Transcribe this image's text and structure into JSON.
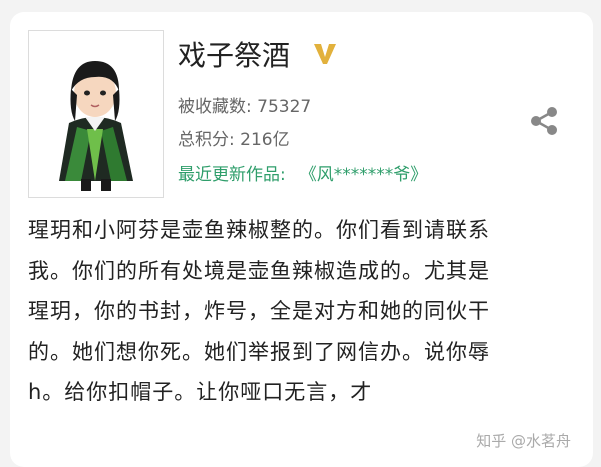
{
  "profile": {
    "author_name": "戏子祭酒",
    "favorites_label": "被收藏数:",
    "favorites_value": "75327",
    "score_label": "总积分:",
    "score_value": "216亿",
    "latest_label": "最近更新作品:",
    "latest_work": "《风*******爷》"
  },
  "icons": {
    "vip": "vip-v-icon",
    "share": "share-icon"
  },
  "colors": {
    "accent_green": "#2f9e6b",
    "vip_gold": "#e2b13c"
  },
  "body_lines": [
    "瑆玥和小阿芬是壶鱼辣椒整的。你们看到请联系",
    "我。你们的所有处境是壶鱼辣椒造成的。尤其是",
    "瑆玥，你的书封，炸号，全是对方和她的同伙干",
    "的。她们想你死。她们举报到了网信办。说你辱",
    "h。给你扣帽子。让你哑口无言，才"
  ],
  "watermark": "知乎 @水茗舟"
}
